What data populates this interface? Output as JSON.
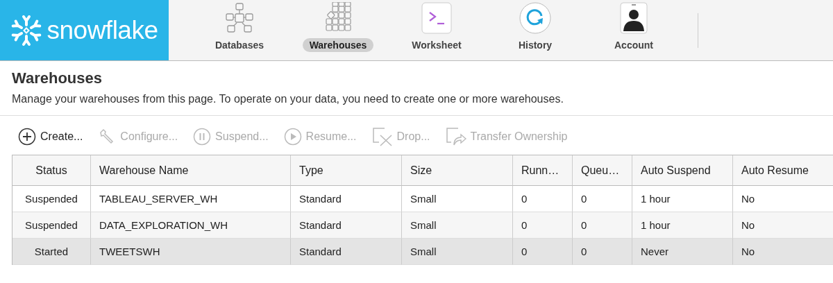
{
  "logo": {
    "text": "snowflake"
  },
  "nav": [
    {
      "label": "Databases",
      "kind": "databases",
      "selected": false
    },
    {
      "label": "Warehouses",
      "kind": "warehouses",
      "selected": true
    },
    {
      "label": "Worksheet",
      "kind": "worksheet",
      "selected": false
    },
    {
      "label": "History",
      "kind": "history",
      "selected": false
    },
    {
      "label": "Account",
      "kind": "account",
      "selected": false
    }
  ],
  "page": {
    "title": "Warehouses",
    "description": "Manage your warehouses from this page. To operate on your data, you need to create one or more warehouses."
  },
  "toolbar": [
    {
      "label": "Create...",
      "kind": "create",
      "disabled": false
    },
    {
      "label": "Configure...",
      "kind": "configure",
      "disabled": true
    },
    {
      "label": "Suspend...",
      "kind": "suspend",
      "disabled": true
    },
    {
      "label": "Resume...",
      "kind": "resume",
      "disabled": true
    },
    {
      "label": "Drop...",
      "kind": "drop",
      "disabled": true
    },
    {
      "label": "Transfer Ownership",
      "kind": "transfer",
      "disabled": true
    }
  ],
  "table": {
    "columns": [
      "Status",
      "Warehouse Name",
      "Type",
      "Size",
      "Runn…",
      "Queu…",
      "Auto Suspend",
      "Auto Resume"
    ],
    "rows": [
      {
        "cells": [
          "Suspended",
          "TABLEAU_SERVER_WH",
          "Standard",
          "Small",
          "0",
          "0",
          "1 hour",
          "No"
        ],
        "selected": false
      },
      {
        "cells": [
          "Suspended",
          "DATA_EXPLORATION_WH",
          "Standard",
          "Small",
          "0",
          "0",
          "1 hour",
          "No"
        ],
        "selected": false
      },
      {
        "cells": [
          "Started",
          "TWEETSWH",
          "Standard",
          "Small",
          "0",
          "0",
          "Never",
          "No"
        ],
        "selected": true
      }
    ]
  }
}
